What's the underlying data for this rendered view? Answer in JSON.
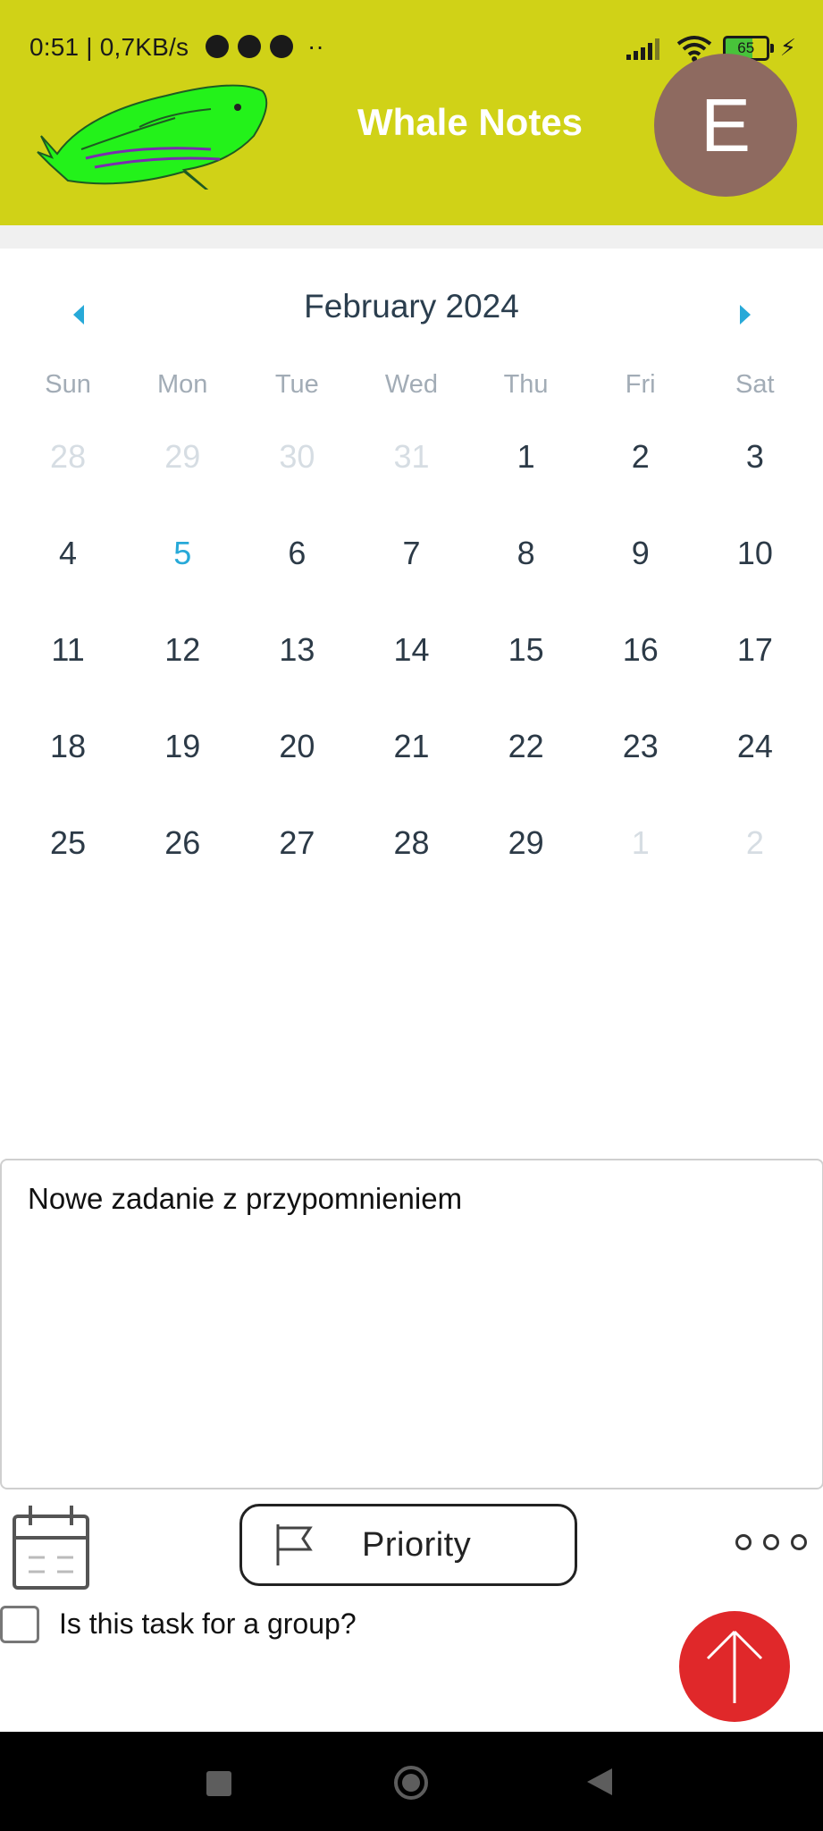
{
  "status_bar": {
    "time_speed": "0:51 | 0,7KB/s",
    "more": "··",
    "battery": "65"
  },
  "header": {
    "title": "Whale Notes",
    "avatar_letter": "E",
    "background_color": "#d0d217"
  },
  "calendar": {
    "month_label": "February 2024",
    "weekdays": [
      "Sun",
      "Mon",
      "Tue",
      "Wed",
      "Thu",
      "Fri",
      "Sat"
    ],
    "today": "5",
    "accent_color": "#27a9d8",
    "weeks": [
      [
        "28",
        "29",
        "30",
        "31",
        "1",
        "2",
        "3"
      ],
      [
        "4",
        "5",
        "6",
        "7",
        "8",
        "9",
        "10"
      ],
      [
        "11",
        "12",
        "13",
        "14",
        "15",
        "16",
        "17"
      ],
      [
        "18",
        "19",
        "20",
        "21",
        "22",
        "23",
        "24"
      ],
      [
        "25",
        "26",
        "27",
        "28",
        "29",
        "1",
        "2"
      ]
    ]
  },
  "task": {
    "text": "Nowe zadanie z przypomnieniem",
    "priority_label": "Priority",
    "group_question": "Is this task for a group?",
    "group_checked": false
  },
  "icons": {
    "calendar": "calendar-icon",
    "priority": "flag-icon",
    "more": "more-horizontal-icon",
    "send": "arrow-up-icon",
    "send_color": "#e0282a"
  }
}
